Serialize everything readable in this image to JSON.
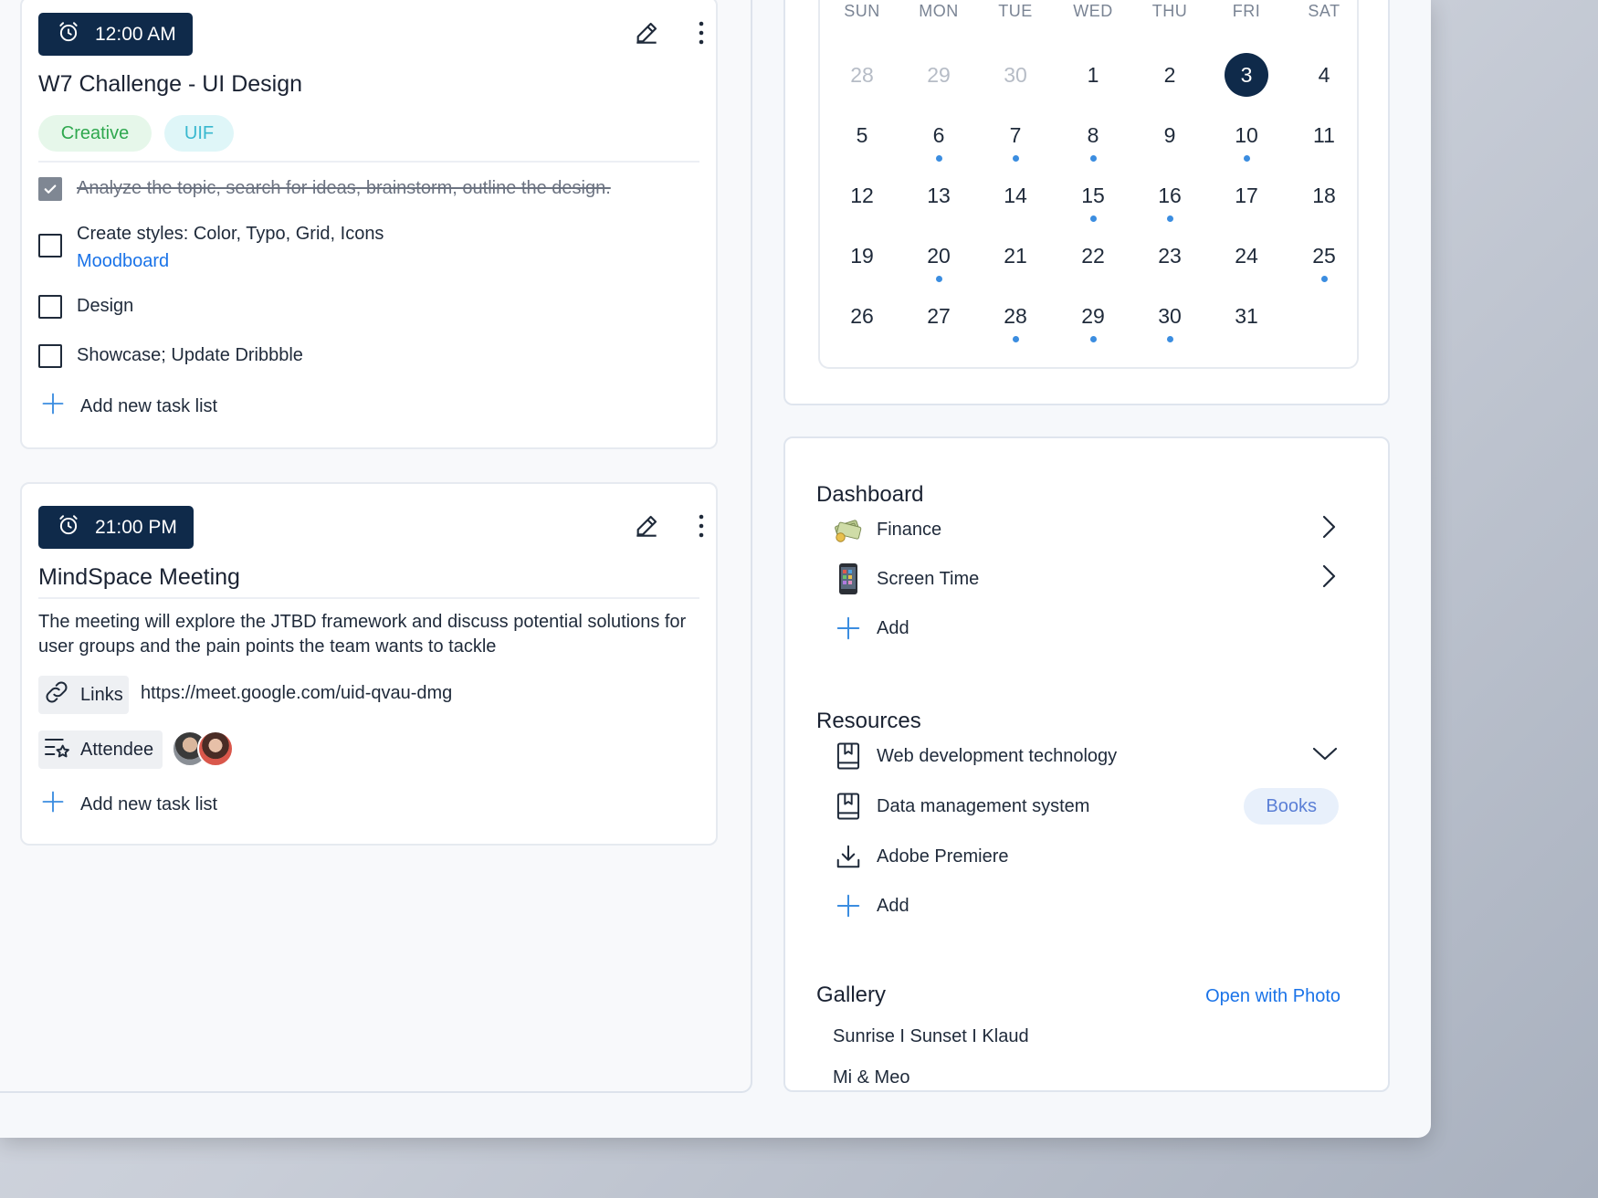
{
  "tasks": [
    {
      "time": "12:00 AM",
      "title": "W7 Challenge - UI Design",
      "tags": [
        {
          "label": "Creative",
          "bg": "#e6f7ea",
          "color": "#2fa84f"
        },
        {
          "label": "UIF",
          "bg": "#dff6f8",
          "color": "#39b8cf"
        }
      ],
      "checklist": [
        {
          "text": "Analyze the topic, search for ideas, brainstorm, outline the design.",
          "done": true
        },
        {
          "text": "Create styles: Color, Typo, Grid, Icons",
          "link": "Moodboard",
          "done": false
        },
        {
          "text": "Design",
          "done": false
        },
        {
          "text": "Showcase; Update Dribbble",
          "done": false
        }
      ],
      "add_label": "Add new task list"
    },
    {
      "time": "21:00 PM",
      "title": "MindSpace Meeting",
      "description": "The meeting will explore the JTBD framework and discuss potential solutions for user groups and the pain points the team wants to tackle",
      "links_label": "Links",
      "link_url": "https://meet.google.com/uid-qvau-dmg",
      "attendee_label": "Attendee",
      "add_label": "Add new task list"
    }
  ],
  "calendar": {
    "weekdays": [
      "SUN",
      "MON",
      "TUE",
      "WED",
      "THU",
      "FRI",
      "SAT"
    ],
    "weeks": [
      [
        {
          "d": "28",
          "muted": true
        },
        {
          "d": "29",
          "muted": true
        },
        {
          "d": "30",
          "muted": true
        },
        {
          "d": "1"
        },
        {
          "d": "2"
        },
        {
          "d": "3",
          "today": true
        },
        {
          "d": "4"
        }
      ],
      [
        {
          "d": "5"
        },
        {
          "d": "6",
          "dot": true
        },
        {
          "d": "7",
          "dot": true
        },
        {
          "d": "8",
          "dot": true
        },
        {
          "d": "9"
        },
        {
          "d": "10",
          "dot": true
        },
        {
          "d": "11"
        }
      ],
      [
        {
          "d": "12"
        },
        {
          "d": "13"
        },
        {
          "d": "14"
        },
        {
          "d": "15",
          "dot": true
        },
        {
          "d": "16",
          "dot": true
        },
        {
          "d": "17"
        },
        {
          "d": "18"
        }
      ],
      [
        {
          "d": "19"
        },
        {
          "d": "20",
          "dot": true
        },
        {
          "d": "21"
        },
        {
          "d": "22"
        },
        {
          "d": "23"
        },
        {
          "d": "24"
        },
        {
          "d": "25",
          "dot": true
        }
      ],
      [
        {
          "d": "26"
        },
        {
          "d": "27"
        },
        {
          "d": "28",
          "dot": true
        },
        {
          "d": "29",
          "dot": true
        },
        {
          "d": "30",
          "dot": true
        },
        {
          "d": "31"
        }
      ]
    ]
  },
  "dashboard": {
    "title": "Dashboard",
    "items": [
      {
        "label": "Finance",
        "icon": "money-icon"
      },
      {
        "label": "Screen Time",
        "icon": "phone-icon"
      }
    ],
    "add_label": "Add"
  },
  "resources": {
    "title": "Resources",
    "items": [
      {
        "label": "Web development technology",
        "icon": "bookmark-book-icon"
      },
      {
        "label": "Data management system",
        "icon": "bookmark-book-icon",
        "badge": "Books"
      },
      {
        "label": "Adobe Premiere",
        "icon": "download-icon"
      }
    ],
    "add_label": "Add"
  },
  "gallery": {
    "title": "Gallery",
    "open_label": "Open with Photo",
    "items": [
      "Sunrise I Sunset I Klaud",
      "Mi & Meo"
    ]
  }
}
